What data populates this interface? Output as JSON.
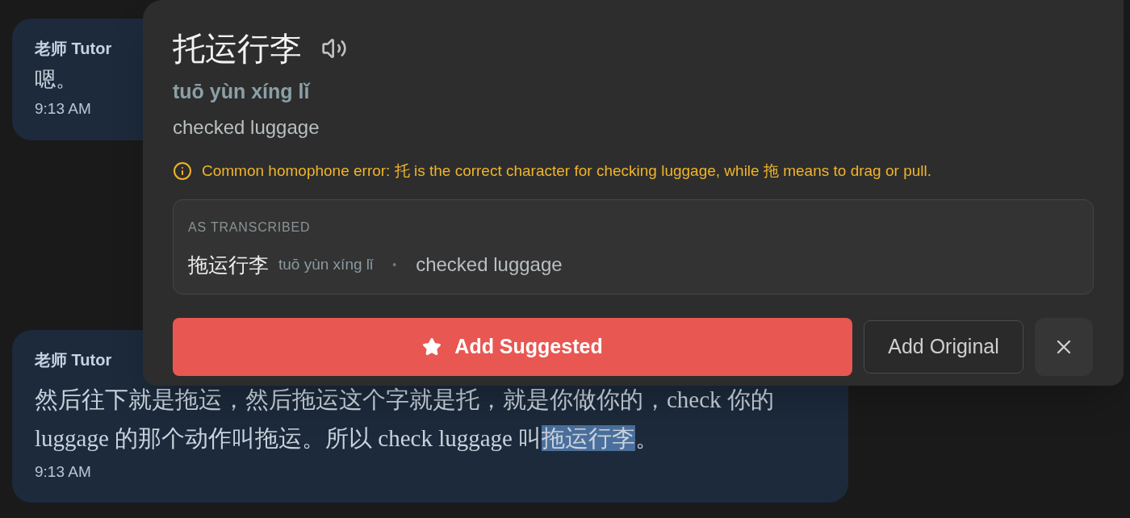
{
  "messages": [
    {
      "sender": "老师 Tutor",
      "segments": [
        {
          "text": "嗯。",
          "selected": false
        }
      ],
      "time": "9:13 AM"
    },
    {
      "sender": "老师 Tutor",
      "segments": [
        {
          "text": "然后往下就是拖运，然后拖运这个字就是托，就是你做你的，check 你的 luggage 的那个动作叫拖运。所以 check luggage 叫",
          "selected": false
        },
        {
          "text": "拖运行李",
          "selected": true
        },
        {
          "text": "。",
          "selected": false
        }
      ],
      "time": "9:13 AM"
    }
  ],
  "popover": {
    "word": "托运行李",
    "pinyin": "tuō yùn xíng lǐ",
    "meaning": "checked luggage",
    "warning": "Common homophone error: 托 is the correct character for checking luggage, while 拖 means to drag or pull.",
    "transcribed": {
      "label": "AS TRANSCRIBED",
      "word": "拖运行李",
      "pinyin": "tuō yùn xíng lǐ",
      "separator": "•",
      "meaning": "checked luggage"
    },
    "buttons": [
      {
        "kind": "primary",
        "label": "Add Suggested"
      },
      {
        "kind": "secondary",
        "label": "Add Original"
      },
      {
        "kind": "close"
      }
    ]
  }
}
